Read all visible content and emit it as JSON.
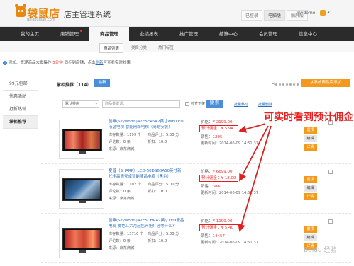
{
  "header": {
    "logo_name": "袋鼠店",
    "logo_domain": "daishudian.com",
    "app_title": "店主管理系统",
    "links": [
      "已登录",
      "电脑版",
      "触屏版"
    ],
    "user": "mydemo",
    "user_caret": "▾"
  },
  "nav": [
    "我的主页",
    "店铺管理",
    "商品管理",
    "业绩报表",
    "推广管理",
    "结算中心",
    "会员管理",
    "信息中心"
  ],
  "subnav": [
    "商品列表",
    "类目分类",
    "热门标签"
  ],
  "notice": {
    "icon": "i",
    "text_a": "添加、管理商品大概操作 ",
    "highlight": "5分钟",
    "text_b": " 同步到店铺，点击",
    "link": "刷新",
    "text_c": "可查看实时效果"
  },
  "sidebar": [
    "99元包邮",
    "优惠活动",
    "打折热销",
    "掌柜推荐"
  ],
  "list": {
    "tab_label": "掌柜推荐（114）",
    "tab_new": "最新",
    "pager_arrow": "<",
    "add_button": "从系统商品库添加",
    "sort_select": "默认排序",
    "keyword_placeholder": "商品关键词：",
    "checkbox_label": "检查下架",
    "search_button": "搜 索",
    "batch_links": [
      "批量移动",
      "批量删除"
    ],
    "field_labels": {
      "inventory": "库存数量：",
      "rating": "商品评分：",
      "reviews": "评论数：",
      "discount": "折扣：",
      "source": "来源：",
      "price": "价格：",
      "commission": "预计佣金：",
      "sales": "销售：",
      "updated": "更新时间："
    },
    "actions": [
      "置顶",
      "编辑",
      "详情"
    ],
    "items": [
      {
        "title": "创维(Skyworth)42E5ERS42英寸wifi LED液晶电视 智能网络电视（简易安装）",
        "inventory": "1199 个",
        "rating": "5.00 分",
        "reviews": "0 条",
        "discount": "10.0",
        "source": "京东商城",
        "price": "¥ 2199.00",
        "commission": "¥ 5.94",
        "sales": "1205",
        "updated": "2014-06-09 14:51:37"
      },
      {
        "title": "夏普（SHARP）LCD-50DS60A50英寸新一代全高清安卓智能液晶电视（黑色）",
        "inventory": "1102 个",
        "rating": "5.00 分",
        "reviews": "0 条",
        "discount": "10.0",
        "source": "京东商城",
        "price": "¥ 6699.00",
        "commission": "¥ 18.09",
        "sales": "386",
        "updated": "2014-06-09 14:51:37"
      },
      {
        "title": "创维(Skyworth)42E5CHR42英寸LED液晶电视 爱色红六月起售开抢！还等什么？",
        "inventory": "13710 个",
        "rating": "5.00 分",
        "reviews": "0 条",
        "discount": "10.0",
        "source": "京东商城",
        "price": "¥ 1999.00",
        "commission": "¥ 5.40",
        "sales": "14457",
        "updated": "2014-06-09 14:51:37"
      }
    ]
  },
  "annotation": "可实时看到预计佣金",
  "watermark": "Baidu 经验",
  "colors": {
    "brand_orange": "#e8880f",
    "nav_dark": "#2b2b2b",
    "accent_blue": "#4a8ed8",
    "action_orange": "#f39a1e",
    "annotation_red": "#e82020"
  }
}
